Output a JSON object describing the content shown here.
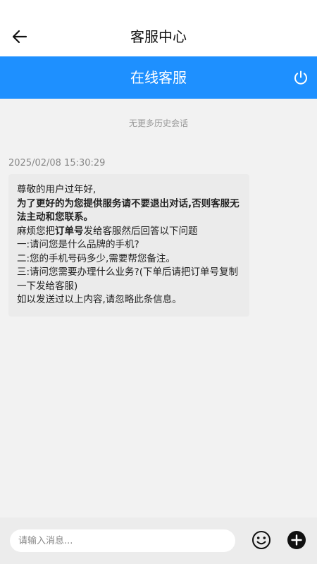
{
  "header": {
    "title": "客服中心",
    "back_icon": "arrow-left-icon"
  },
  "service_bar": {
    "title": "在线客服",
    "power_icon": "power-icon",
    "color": "#1e90ff"
  },
  "chat": {
    "no_history": "无更多历史会话",
    "messages": [
      {
        "time": "2025/02/08 15:30:29",
        "lines": {
          "l1": "尊敬的用户过年好,",
          "l2": "为了更好的为您提供服务请不要退出对话,否则客服无法主动和您联系。",
          "l3_pre": "麻烦您把",
          "l3_bold": "订单号",
          "l3_post": "发给客服然后回答以下问题",
          "l4": "一:请问您是什么品牌的手机?",
          "l5": "二:您的手机号码多少,需要帮您备注。",
          "l6": "三:请问您需要办理什么业务?(下单后请把订单号复制一下发给客服)",
          "l7": "如以发送过以上内容,请忽略此条信息。"
        }
      }
    ]
  },
  "input_bar": {
    "placeholder": "请输入消息...",
    "emoji_icon": "emoji-icon",
    "plus_icon": "plus-icon"
  }
}
